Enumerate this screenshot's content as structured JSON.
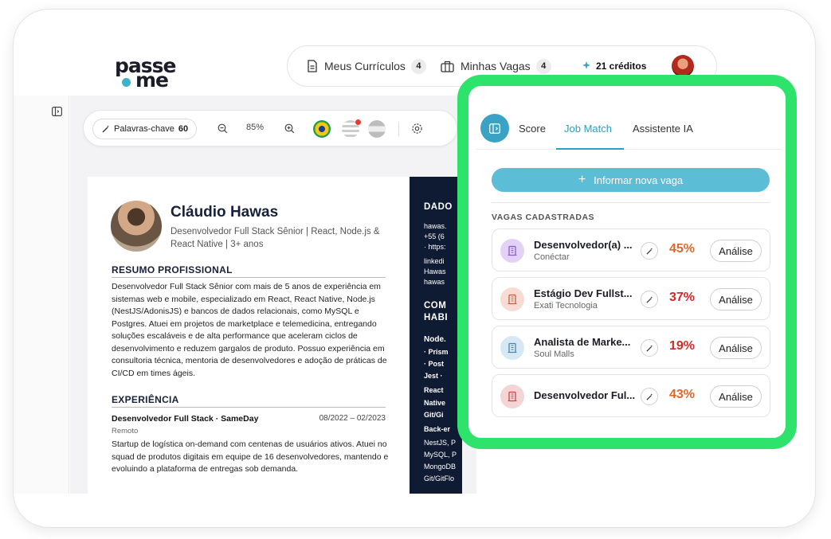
{
  "brand": {
    "line1": "passe",
    "line2": "me",
    "dot_color": "#3bb2d0"
  },
  "topnav": {
    "curriculos": {
      "label": "Meus Currículos",
      "count": "4",
      "icon": "document-icon"
    },
    "vagas": {
      "label": "Minhas Vagas",
      "count": "4",
      "icon": "briefcase-icon"
    },
    "creditos": {
      "label": "21 créditos",
      "icon": "sparkle-icon"
    }
  },
  "toolbar": {
    "keywords_label": "Palavras-chave",
    "keywords_count": "60",
    "zoom": "85%",
    "flags": [
      "brazil-flag",
      "usa-flag",
      "argentina-flag"
    ]
  },
  "resume": {
    "name": "Cláudio Hawas",
    "role": "Desenvolvedor Full Stack Sênior | React, Node.js & React Native | 3+ anos",
    "summary_title": "RESUMO PROFISSIONAL",
    "summary": "Desenvolvedor Full Stack Sênior com mais de 5 anos de experiência em sistemas web e mobile, especializado em React, React Native, Node.js (NestJS/AdonisJS) e bancos de dados relacionais, como MySQL e Postgres. Atuei em projetos de marketplace e telemedicina, entregando soluções escaláveis e de alta performance que aceleram ciclos de desenvolvimento e reduzem gargalos de produto. Possuo experiência em consultoria técnica, mentoria de desenvolvedores e adoção de práticas de CI/CD em times ágeis.",
    "experience_title": "EXPERIÊNCIA",
    "job_title": "Desenvolvedor Full Stack · SameDay",
    "job_period": "08/2022 – 02/2023",
    "job_location": "Remoto",
    "job_desc": "Startup de logística on-demand com centenas de usuários ativos. Atuei no squad de produtos digitais em equipe de 16 desenvolvedores, mantendo e evoluindo a plataforma de entregas sob demanda.",
    "side": {
      "h1": "DADO",
      "contacts": [
        "hawas.",
        "+55 (6",
        "· https:",
        "linkedi",
        "Hawas",
        "hawas"
      ],
      "h2a": "COM",
      "h2b": "HABI",
      "skills": [
        "Node.",
        "· Prism",
        "· Post",
        "Jest ·",
        "React",
        "Native",
        "Git/Gi",
        "Back-er",
        "NestJS, P",
        "MySQL, P",
        "MongoDB",
        "Git/GitFlo"
      ]
    }
  },
  "panel": {
    "tabs": [
      "Score",
      "Job Match",
      "Assistente IA"
    ],
    "active_tab": "Job Match",
    "add_button": "Informar nova vaga",
    "list_title": "VAGAS CADASTRADAS",
    "jobs": [
      {
        "title": "Desenvolvedor(a) ...",
        "company": "Conéctar",
        "match": "45%",
        "match_color": "#e0662a",
        "icon_bg": "#e3d2f5",
        "icon_fg": "#8a5cc9",
        "action": "Análise"
      },
      {
        "title": "Estágio Dev Fullst...",
        "company": "Exati Tecnologia",
        "match": "37%",
        "match_color": "#d62828",
        "icon_bg": "#f6dcd3",
        "icon_fg": "#c0624a",
        "action": "Análise"
      },
      {
        "title": "Analista de Marke...",
        "company": "Soul Malls",
        "match": "19%",
        "match_color": "#d62828",
        "icon_bg": "#d5e8f4",
        "icon_fg": "#4d84ad",
        "action": "Análise"
      },
      {
        "title": "Desenvolvedor Ful...",
        "company": "",
        "match": "43%",
        "match_color": "#e0662a",
        "icon_bg": "#f4d4d4",
        "icon_fg": "#c24a4a",
        "action": "Análise"
      }
    ]
  }
}
